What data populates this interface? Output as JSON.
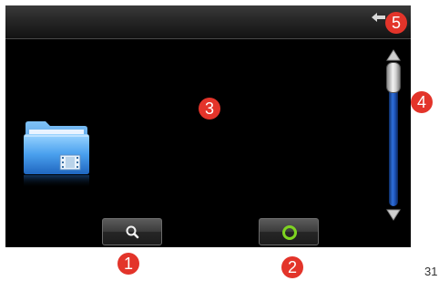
{
  "callouts": {
    "c1": "1",
    "c2": "2",
    "c3": "3",
    "c4": "4",
    "c5": "5"
  },
  "footer": {
    "page_number": "31"
  },
  "icons": {
    "back": "back-arrow-icon",
    "folder": "video-folder-icon",
    "search": "search-icon",
    "refresh": "refresh-icon",
    "scroll_up": "scroll-up-icon",
    "scroll_down": "scroll-down-icon"
  },
  "colors": {
    "screen_background": "#000000",
    "callout": "#e3342a",
    "scroll_track": "#2f6fdb",
    "refresh_button_accent": "#7ed321",
    "folder": "#3d8fe0"
  }
}
